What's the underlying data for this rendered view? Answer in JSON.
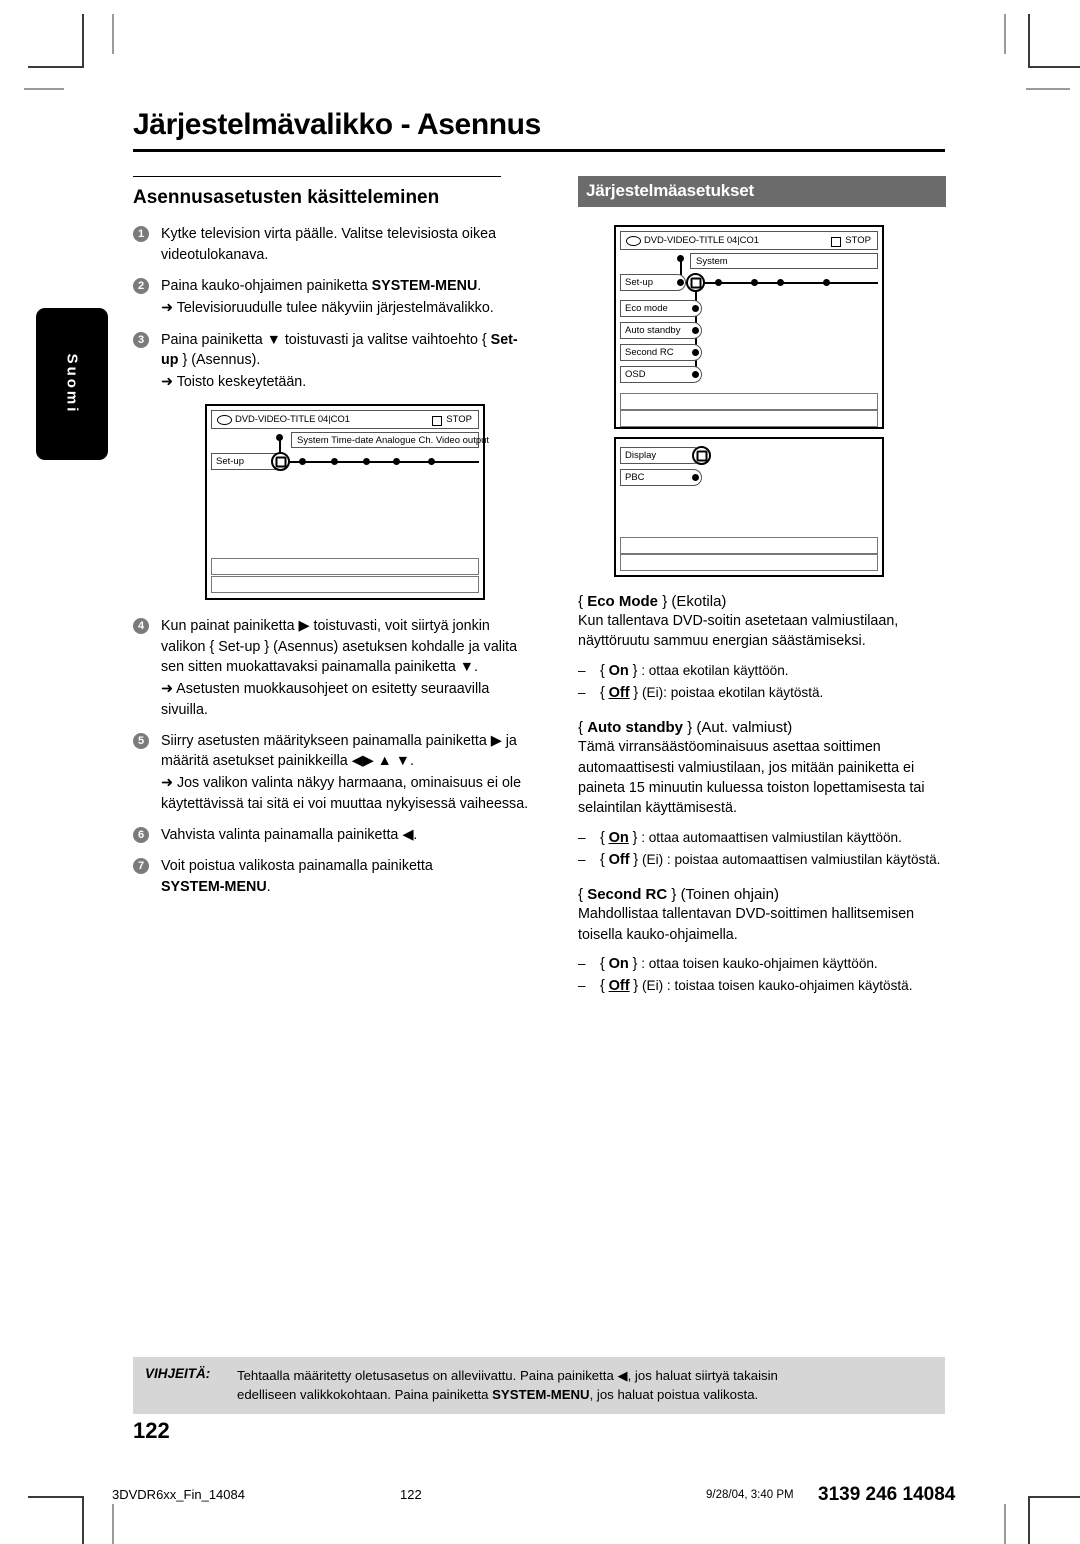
{
  "page_title": "Järjestelmävalikko - Asennus",
  "language_tab": "Suomi",
  "left": {
    "heading": "Asennusasetusten käsitteleminen",
    "steps": [
      {
        "num": "1",
        "text": "Kytke television virta päälle. Valitse televisiosta oikea videotulokanava."
      },
      {
        "num": "2",
        "text_pre": "Paina kauko-ohjaimen painiketta ",
        "bold": "SYSTEM-MENU",
        "text_post": ".",
        "sub": "➜ Televisioruudulle tulee näkyviin järjestelmävalikko."
      },
      {
        "num": "3",
        "text_pre": "Paina painiketta ▼ toistuvasti ja valitse vaihtoehto { ",
        "bold": "Set-up",
        "text_post": " } (Asennus).",
        "sub": "➜ Toisto keskeytetään."
      },
      {
        "num": "4",
        "text": "Kun painat painiketta ▶ toistuvasti, voit siirtyä jonkin valikon { Set-up } (Asennus) asetuksen kohdalle ja valita sen sitten muokattavaksi painamalla painiketta ▼.",
        "sub": "➜ Asetusten muokkausohjeet on esitetty seuraavilla sivuilla."
      },
      {
        "num": "5",
        "text": "Siirry asetusten määritykseen painamalla painiketta ▶ ja määritä asetukset painikkeilla ◀▶ ▲ ▼.",
        "sub": "➜ Jos valikon valinta näkyy harmaana, ominaisuus ei ole käytettävissä tai sitä ei voi muuttaa nykyisessä vaiheessa."
      },
      {
        "num": "6",
        "text": "Vahvista valinta painamalla painiketta ◀."
      },
      {
        "num": "7",
        "text_pre": "Voit poistua valikosta painamalla painiketta ",
        "bold": "SYSTEM-MENU",
        "text_post": "."
      }
    ]
  },
  "right": {
    "heading": "Järjestelmäasetukset",
    "sections": [
      {
        "title_brace_open": "{",
        "title_bold": "Eco Mode",
        "title_brace_close": "}",
        "title_translation": "(Ekotila)",
        "body": "Kun tallentava DVD-soitin asetetaan valmiustilaan, näyttöruutu sammuu energian säästämiseksi.",
        "bullets": [
          {
            "key": "On",
            "default": false,
            "translation": "",
            "desc": ": ottaa ekotilan käyttöön."
          },
          {
            "key": "Off",
            "default": true,
            "translation": "(Ei)",
            "desc": ": poistaa ekotilan käytöstä."
          }
        ]
      },
      {
        "title_brace_open": "{",
        "title_bold": "Auto standby",
        "title_brace_close": "}",
        "title_translation": "(Aut. valmiust)",
        "body": "Tämä virransäästöominaisuus asettaa soittimen automaattisesti valmiustilaan, jos mitään painiketta ei paineta 15 minuutin kuluessa toiston lopettamisesta tai selaintilan käyttämisestä.",
        "bullets": [
          {
            "key": "On",
            "default": true,
            "translation": "",
            "desc": ": ottaa automaattisen valmiustilan käyttöön."
          },
          {
            "key": "Off",
            "default": false,
            "translation": "(Ei)",
            "desc": " : poistaa automaattisen valmiustilan käytöstä."
          }
        ]
      },
      {
        "title_brace_open": "{",
        "title_bold": "Second RC",
        "title_brace_close": "}",
        "title_translation": "(Toinen ohjain)",
        "body": "Mahdollistaa tallentavan DVD-soittimen hallitsemisen toisella kauko-ohjaimella.",
        "bullets": [
          {
            "key": "On",
            "default": false,
            "translation": "",
            "desc": ": ottaa toisen kauko-ohjaimen käyttöön."
          },
          {
            "key": "Off",
            "default": true,
            "translation": "(Ei)",
            "desc": " : toistaa toisen kauko-ohjaimen käytöstä."
          }
        ]
      }
    ]
  },
  "tv_screens": {
    "status_bar": {
      "disc_label": "DVD-VIDEO-TITLE 04|CO1",
      "stop_label": "STOP"
    },
    "screen1": {
      "menu_strip": "System  Time-date  Analogue Ch.  Video output",
      "setup_label": "Set-up"
    },
    "screen2": {
      "menu_strip": "System",
      "setup_label": "Set-up",
      "items": [
        "Eco mode",
        "Auto standby",
        "Second RC",
        "OSD"
      ]
    },
    "screen3": {
      "items": [
        "Display",
        "PBC"
      ]
    }
  },
  "tips": {
    "label": "VIHJEITÄ:",
    "line1_pre": "Tehtaalla määritetty oletusasetus on alleviivattu.  Paina painiketta ◀, jos haluat siirtyä takaisin",
    "line2_pre": "edelliseen valikkokohtaan.  Paina painiketta ",
    "line2_bold": "SYSTEM-MENU",
    "line2_post": ", jos haluat poistua valikosta."
  },
  "folio": "122",
  "footer": {
    "file": "3DVDR6xx_Fin_14084",
    "page": "122",
    "date": "9/28/04, 3:40 PM",
    "code": "3139 246 14084"
  },
  "colors": {
    "heading_bar": "#6b6b6b",
    "tips_bg": "#d6d6d6",
    "step_num_bg": "#7b7b7b",
    "lang_tab_bg": "#000000"
  }
}
